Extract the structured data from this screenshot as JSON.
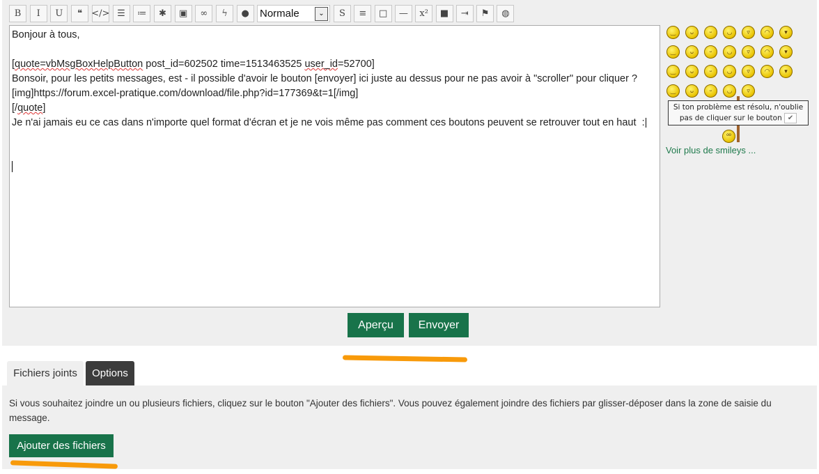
{
  "toolbar": {
    "buttons": [
      {
        "icon": "bold-icon",
        "glyph": "B"
      },
      {
        "icon": "italic-icon",
        "glyph": "I"
      },
      {
        "icon": "underline-icon",
        "glyph": "U"
      },
      {
        "icon": "quote-icon",
        "glyph": "❝"
      },
      {
        "icon": "code-icon",
        "glyph": "</>"
      },
      {
        "icon": "bullet-list-icon",
        "glyph": "☰"
      },
      {
        "icon": "numbered-list-icon",
        "glyph": "≔"
      },
      {
        "icon": "asterisk-icon",
        "glyph": "✱"
      },
      {
        "icon": "image-icon",
        "glyph": "▣"
      },
      {
        "icon": "link-icon",
        "glyph": "∞"
      },
      {
        "icon": "flash-icon",
        "glyph": "ϟ"
      },
      {
        "icon": "color-drop-icon",
        "glyph": "●"
      }
    ],
    "font_size_select": "Normale",
    "buttons2": [
      {
        "icon": "strikethrough-icon",
        "glyph": "S"
      },
      {
        "icon": "align-center-icon",
        "glyph": "≡"
      },
      {
        "icon": "box-icon",
        "glyph": "□"
      },
      {
        "icon": "horizontal-rule-icon",
        "glyph": "—"
      },
      {
        "icon": "superscript-icon",
        "glyph": "x²"
      },
      {
        "icon": "block-icon",
        "glyph": "■"
      },
      {
        "icon": "indent-icon",
        "glyph": "⇥"
      },
      {
        "icon": "flag-icon",
        "glyph": "⚑"
      },
      {
        "icon": "spoiler-hidden-icon",
        "glyph": "◍"
      }
    ]
  },
  "message": {
    "line1": "Bonjour à tous,",
    "quote_open_pre": "[",
    "quote_open_word": "quote=vbMsgBoxHelpButton",
    "quote_open_mid": " post_id=602502 time=1513463525 ",
    "quote_open_user": "user_id",
    "quote_open_post": "=52700]",
    "line3": "Bonsoir, pour les petits messages, est - il possible d'avoir le bouton [envoyer] ici juste au dessus pour ne pas avoir à \"scroller\" pour cliquer ?",
    "line4": "[img]https://forum.excel-pratique.com/download/file.php?id=177369&t=1[/img]",
    "quote_close_pre": "[/",
    "quote_close_word": "quote",
    "quote_close_post": "]",
    "line6": "Je n'ai jamais eu ce cas dans n'importe quel format d'écran et je ne vois même pas comment ces boutons peuvent se retrouver tout en haut  :|"
  },
  "smileys": {
    "count": 26,
    "note": "Si ton problème est résolu, n'oublie pas de cliquer sur le bouton",
    "note_check": "✔",
    "more_link": "Voir plus de smileys ..."
  },
  "actions": {
    "preview": "Aperçu",
    "send": "Envoyer"
  },
  "tabs": {
    "attachments": "Fichiers joints",
    "options": "Options"
  },
  "attachments": {
    "info": "Si vous souhaitez joindre un ou plusieurs fichiers, cliquez sur le bouton \"Ajouter des fichiers\". Vous pouvez également joindre des fichiers par glisser-déposer dans la zone de saisie du message.",
    "add_button": "Ajouter des fichiers"
  },
  "colors": {
    "accent": "#18734a",
    "highlight": "#f89a0a",
    "tab_active": "#3c3c3c"
  }
}
